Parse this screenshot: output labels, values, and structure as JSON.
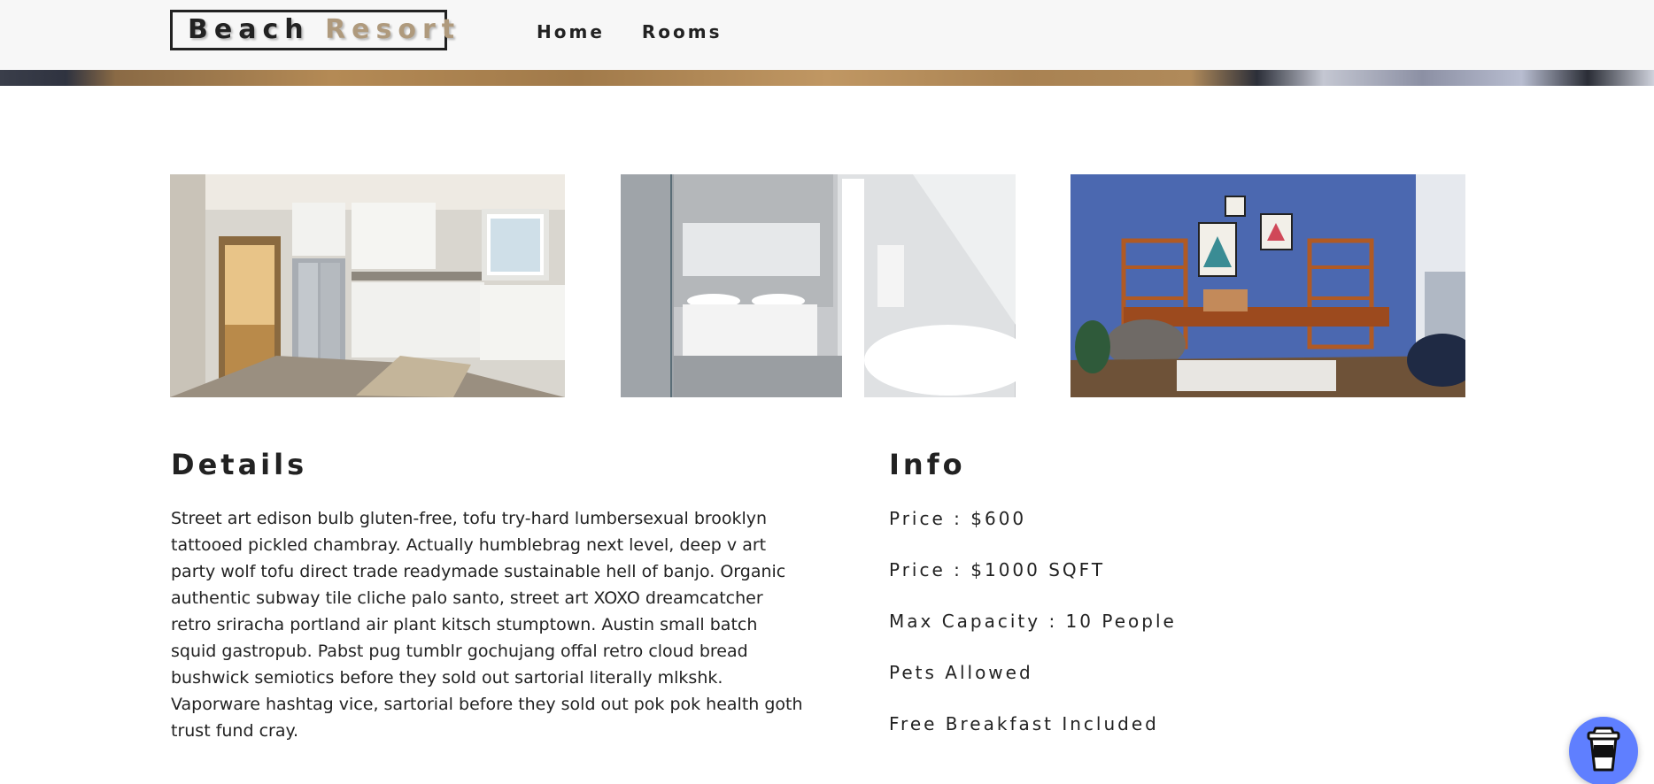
{
  "navbar": {
    "logo_word1": "Beach",
    "logo_word2": "Resort",
    "links": [
      {
        "label": "Home"
      },
      {
        "label": "Rooms"
      }
    ]
  },
  "gallery": {
    "photos": [
      {
        "subject": "kitchen"
      },
      {
        "subject": "bathroom"
      },
      {
        "subject": "office"
      }
    ]
  },
  "details": {
    "title": "Details",
    "text": "Street art edison bulb gluten-free, tofu try-hard lumbersexual brooklyn tattooed pickled chambray. Actually humblebrag next level, deep v art party wolf tofu direct trade readymade sustainable hell of banjo. Organic authentic subway tile cliche palo santo, street art XOXO dreamcatcher retro sriracha portland air plant kitsch stumptown. Austin small batch squid gastropub. Pabst pug tumblr gochujang offal retro cloud bread bushwick semiotics before they sold out sartorial literally mlkshk. Vaporware hashtag vice, sartorial before they sold out pok pok health goth trust fund cray."
  },
  "info": {
    "title": "Info",
    "items": [
      "Price : $600",
      "Price : $1000 SQFT",
      "Max Capacity : 10 People",
      "Pets Allowed",
      "Free Breakfast Included"
    ]
  },
  "floating_button": {
    "icon": "coffee-cup-icon",
    "color": "#5f7fff"
  },
  "colors": {
    "accent": "#af9a7d",
    "text": "#222222",
    "navbar_bg": "#f7f7f7"
  }
}
